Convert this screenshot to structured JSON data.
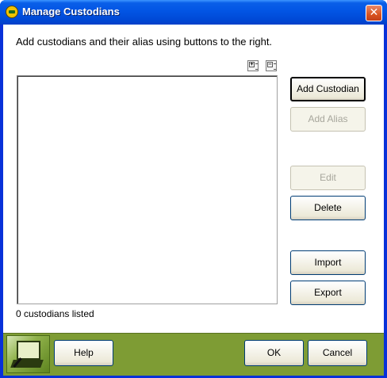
{
  "window": {
    "title": "Manage Custodians",
    "close_glyph": "✕"
  },
  "instructions": "Add custodians and their alias using buttons to the right.",
  "tree_controls": {
    "expand_glyph": "+",
    "collapse_glyph": "−"
  },
  "buttons": {
    "add_custodian": "Add Custodian",
    "add_alias": "Add Alias",
    "edit": "Edit",
    "delete": "Delete",
    "import": "Import",
    "export": "Export"
  },
  "status": "0 custodians listed",
  "footer": {
    "help": "Help",
    "ok": "OK",
    "cancel": "Cancel"
  },
  "colors": {
    "title_bar": "#0255e4",
    "footer_bg": "#7e9c34",
    "close_button": "#d9531f"
  }
}
